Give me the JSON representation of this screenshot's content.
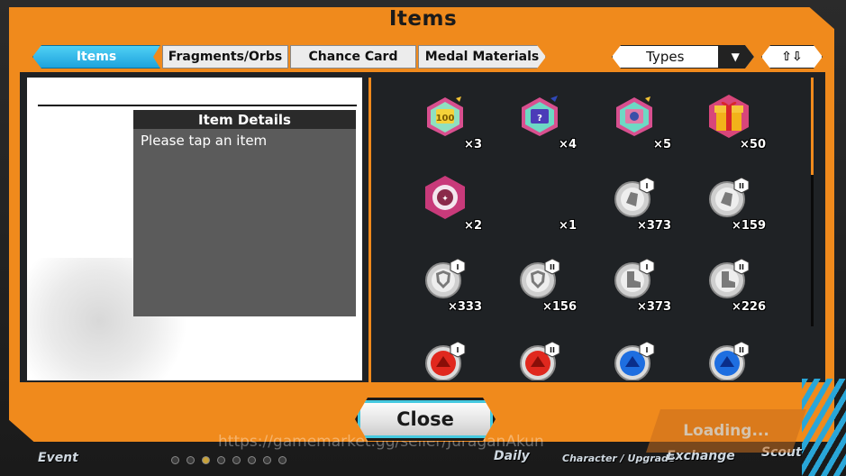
{
  "window": {
    "title": "Items"
  },
  "tabs": [
    {
      "label": "Items",
      "active": true
    },
    {
      "label": "Fragments/Orbs",
      "active": false
    },
    {
      "label": "Chance Card",
      "active": false
    },
    {
      "label": "Medal Materials",
      "active": false
    }
  ],
  "filter": {
    "label": "Types",
    "arrow": "▼"
  },
  "sort": {
    "label": "⇧⇩"
  },
  "details": {
    "heading": "Item Details",
    "hint": "Please tap an item"
  },
  "items": [
    {
      "icon": "green-100-hex-icon",
      "count": "×3"
    },
    {
      "icon": "blue-hex-icon",
      "count": "×4"
    },
    {
      "icon": "pink-hex-icon",
      "count": "×5"
    },
    {
      "icon": "gift-box-icon",
      "count": "×50"
    },
    {
      "icon": "pink-badge-icon",
      "count": "×2"
    },
    {
      "icon": "empty-item-icon",
      "count": "×1"
    },
    {
      "icon": "silver-medal-strength-1-icon",
      "count": "×373"
    },
    {
      "icon": "silver-medal-strength-2-icon",
      "count": "×159"
    },
    {
      "icon": "silver-medal-shield-1-icon",
      "count": "×333"
    },
    {
      "icon": "silver-medal-shield-2-icon",
      "count": "×156"
    },
    {
      "icon": "silver-medal-boot-1-icon",
      "count": "×373"
    },
    {
      "icon": "silver-medal-boot-2-icon",
      "count": "×226"
    },
    {
      "icon": "red-orb-1-icon",
      "count": ""
    },
    {
      "icon": "red-orb-2-icon",
      "count": ""
    },
    {
      "icon": "blue-orb-1-icon",
      "count": ""
    },
    {
      "icon": "blue-orb-2-icon",
      "count": ""
    }
  ],
  "buttons": {
    "close": "Close",
    "loading": "Loading..."
  },
  "nav": {
    "event": "Event",
    "daily": "Daily",
    "upgrade": "Character / Upgrade",
    "exchange": "Exchange",
    "scout": "Scout"
  },
  "watermark": "https://gamemarket.gg/seller/JuraganAkun",
  "colors": {
    "frame": "#f08a1c",
    "tab_active": "#1ea3dc",
    "panel": "#1f2225"
  }
}
